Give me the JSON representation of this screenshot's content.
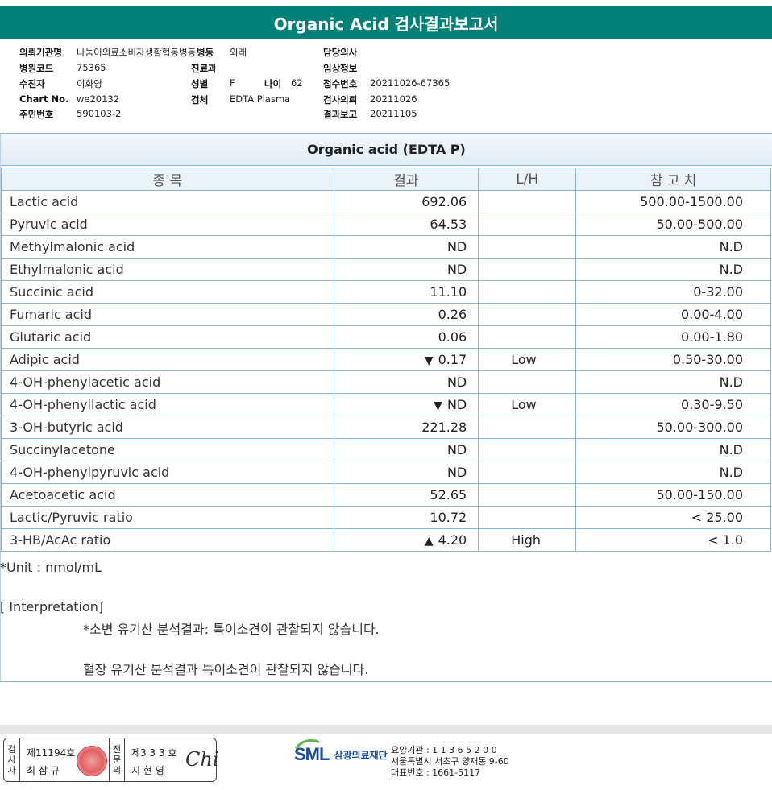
{
  "title": "Organic Acid 검사결과보고서",
  "info": {
    "col1": [
      {
        "label": "의뢰기관명",
        "value": "나눔이의료소비자생활협동병동"
      },
      {
        "label": "병원코드",
        "value": "75365"
      },
      {
        "label": "수진자",
        "value": "이화영"
      },
      {
        "label": "Chart No.",
        "value": "we20132"
      },
      {
        "label": "주민번호",
        "value": "590103-2"
      }
    ],
    "ward_label": "병동",
    "ward_value": "외래",
    "dept_label": "진료과",
    "sex_label": "성별",
    "sex_value": "F",
    "age_label": "나이",
    "age_value": "62",
    "specimen_label": "검체",
    "specimen_value": "EDTA Plasma",
    "col3": [
      {
        "label": "담당의사",
        "value": ""
      },
      {
        "label": "임상정보",
        "value": ""
      },
      {
        "label": "접수번호",
        "value": "20211026-67365"
      },
      {
        "label": "검사의뢰",
        "value": "20211026"
      },
      {
        "label": "결과보고",
        "value": "20211105"
      }
    ]
  },
  "section_title": "Organic acid (EDTA P)",
  "table": {
    "headers": [
      "종 목",
      "결과",
      "L/H",
      "참 고 치"
    ],
    "rows": [
      {
        "name": "Lactic acid",
        "result": "692.06",
        "flag": "",
        "arrow": "",
        "ref": "500.00-1500.00"
      },
      {
        "name": "Pyruvic acid",
        "result": "64.53",
        "flag": "",
        "arrow": "",
        "ref": "50.00-500.00"
      },
      {
        "name": "Methylmalonic acid",
        "result": "ND",
        "flag": "",
        "arrow": "",
        "ref": "N.D"
      },
      {
        "name": "Ethylmalonic acid",
        "result": "ND",
        "flag": "",
        "arrow": "",
        "ref": "N.D"
      },
      {
        "name": "Succinic acid",
        "result": "11.10",
        "flag": "",
        "arrow": "",
        "ref": "0-32.00"
      },
      {
        "name": "Fumaric acid",
        "result": "0.26",
        "flag": "",
        "arrow": "",
        "ref": "0.00-4.00"
      },
      {
        "name": "Glutaric acid",
        "result": "0.06",
        "flag": "",
        "arrow": "",
        "ref": "0.00-1.80"
      },
      {
        "name": "Adipic acid",
        "result": "0.17",
        "flag": "Low",
        "arrow": "▼",
        "ref": "0.50-30.00"
      },
      {
        "name": "4-OH-phenylacetic acid",
        "result": "ND",
        "flag": "",
        "arrow": "",
        "ref": "N.D"
      },
      {
        "name": "4-OH-phenyllactic acid",
        "result": "ND",
        "flag": "Low",
        "arrow": "▼",
        "ref": "0.30-9.50"
      },
      {
        "name": "3-OH-butyric acid",
        "result": "221.28",
        "flag": "",
        "arrow": "",
        "ref": "50.00-300.00"
      },
      {
        "name": "Succinylacetone",
        "result": "ND",
        "flag": "",
        "arrow": "",
        "ref": "N.D"
      },
      {
        "name": "4-OH-phenylpyruvic acid",
        "result": "ND",
        "flag": "",
        "arrow": "",
        "ref": "N.D"
      },
      {
        "name": "Acetoacetic acid",
        "result": "52.65",
        "flag": "",
        "arrow": "",
        "ref": "50.00-150.00"
      },
      {
        "name": "Lactic/Pyruvic ratio",
        "result": "10.72",
        "flag": "",
        "arrow": "",
        "ref": "< 25.00"
      },
      {
        "name": "3-HB/AcAc ratio",
        "result": "4.20",
        "flag": "High",
        "arrow": "▲",
        "ref": "< 1.0"
      }
    ]
  },
  "unit": "*Unit : nmol/mL",
  "interpretation": {
    "label": "[ Interpretation]",
    "line1": "*소변 유기산 분석결과: 특이소견이 관찰되지 않습니다.",
    "line2": "혈장 유기산 분석결과 특이소견이 관찰되지 않습니다."
  },
  "signatures": {
    "tester_label": "검사자",
    "tester_no": "제11194호",
    "tester_name": "최 삼 규",
    "doctor_label": "전문의",
    "doctor_no": "제3 3 3 호",
    "doctor_name": "지 현 영",
    "signature": "Chi"
  },
  "footer": {
    "logo": "SML",
    "org_name": "삼광의료재단",
    "line1": "요양기관 : 1 1 3 6 5 2 0 0",
    "line2": "서울특별시 서초구 양재동 9-60",
    "line3": "대표번호 : 1661-5117"
  }
}
